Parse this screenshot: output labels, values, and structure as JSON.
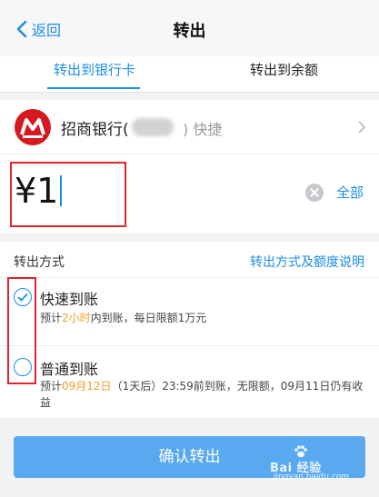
{
  "nav": {
    "back_label": "返回",
    "title": "转出"
  },
  "tabs": [
    {
      "label": "转出到银行卡",
      "active": true
    },
    {
      "label": "转出到余额",
      "active": false
    }
  ],
  "bank": {
    "name": "招商银行(",
    "masked_suffix": ")",
    "tag": "快捷"
  },
  "amount": {
    "value": "¥1",
    "clear_icon": "clear-circle-icon",
    "all_label": "全部"
  },
  "method": {
    "label": "转出方式",
    "link": "转出方式及额度说明",
    "options": [
      {
        "title": "快速到账",
        "selected": true,
        "desc_pre": "预计",
        "desc_hl": "2小时",
        "desc_post": "内到账，每日限额1万元"
      },
      {
        "title": "普通到账",
        "selected": false,
        "desc_pre": "预计",
        "desc_hl": "09月12日",
        "desc_post": "（1天后）23:59前到账，无限额，09月11日仍有收益"
      }
    ]
  },
  "confirm_label": "确认转出",
  "watermark": {
    "text": "Bai 经验",
    "url": "jingyan.baidu.com"
  },
  "colors": {
    "accent": "#1a8ce9",
    "highlight": "#f39a2b",
    "confirm_bg": "#58a9f0",
    "annotation": "#e0262b",
    "bank_logo": "#d6181f"
  }
}
